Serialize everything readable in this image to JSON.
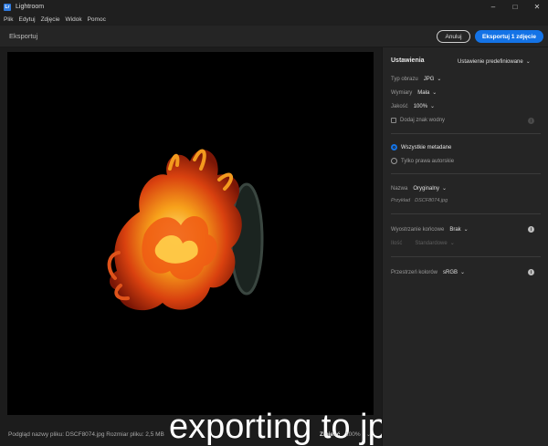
{
  "window": {
    "app_title": "Lightroom",
    "logo_text": "Lr"
  },
  "menu": [
    "Plik",
    "Edytuj",
    "Zdjęcie",
    "Widok",
    "Pomoc"
  ],
  "export_bar": {
    "title": "Eksportuj",
    "cancel_label": "Anuluj",
    "export_label": "Eksportuj 1 zdjęcie"
  },
  "preview": {
    "overlay_text": "exporting to jpg",
    "footer_info": "Podgląd nazwy pliku: DSCF8074.jpg Rozmiar pliku: 2,5 MB",
    "fit_label": "Zmieść",
    "zoom": "100%"
  },
  "settings": {
    "heading": "Ustawienia",
    "preset_label": "Ustawienie predefiniowane",
    "image_type_label": "Typ obrazu",
    "image_type_value": "JPG",
    "dimensions_label": "Wymiary",
    "dimensions_value": "Mała",
    "quality_label": "Jakość",
    "quality_value": "100%",
    "watermark_label": "Dodaj znak wodny",
    "watermark_checked": false,
    "metadata_all_label": "Wszystkie metadane",
    "metadata_copyright_label": "Tylko prawa autorskie",
    "name_label": "Nazwa",
    "name_value": "Oryginalny",
    "example_label": "Przykład",
    "example_value": "DSCF8074.jpg",
    "sharpen_label": "Wyostrzanie końcowe",
    "sharpen_value": "Brak",
    "amount_label": "Ilość",
    "amount_value": "Standardowe",
    "colorspace_label": "Przestrzeń kolorów",
    "colorspace_value": "sRGB"
  },
  "colors": {
    "accent": "#1473e6",
    "background": "#1e1e1e",
    "panel": "#252525"
  }
}
